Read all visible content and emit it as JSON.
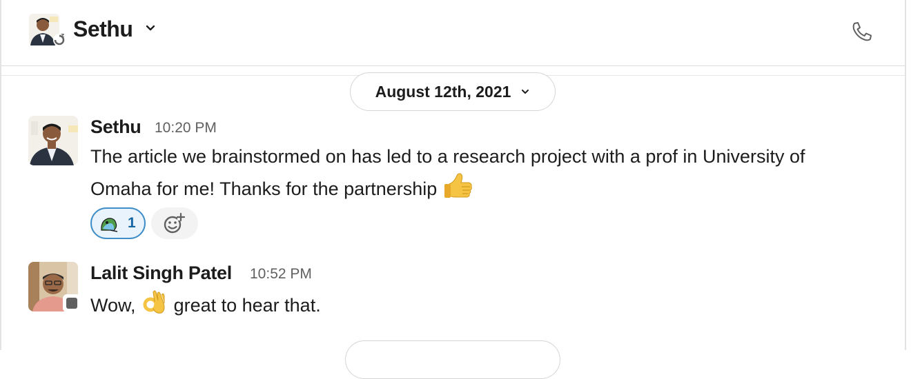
{
  "header": {
    "name": "Sethu",
    "avatar_icon": "user-avatar-sethu",
    "status": "snooze",
    "call_icon": "phone-icon"
  },
  "date_divider": {
    "label": "August 12th, 2021"
  },
  "messages": [
    {
      "sender": "Sethu",
      "time": "10:20 PM",
      "text": "The article we brainstormed on has led to a research project with a prof in University of Omaha for me! Thanks for the partnership",
      "emoji": "thumbs-up",
      "reactions": [
        {
          "emoji": "parrot-icon",
          "count": "1"
        }
      ]
    },
    {
      "sender": "Lalit Singh Patel",
      "time": "10:52 PM",
      "text_before": "Wow,",
      "emoji": "ok-hand",
      "text_after": "great to hear that.",
      "status": "away"
    }
  ],
  "colors": {
    "accent": "#1264a3",
    "reaction_border": "#3e8dc6",
    "reaction_bg": "#e8f3fb"
  }
}
